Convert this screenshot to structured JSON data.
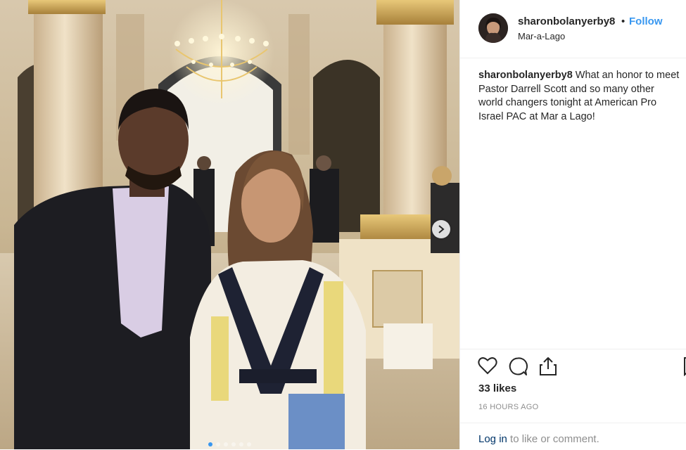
{
  "post": {
    "username": "sharonbolanyerby8",
    "separator": "•",
    "follow_label": "Follow",
    "location": "Mar-a-Lago",
    "caption_username": "sharonbolanyerby8",
    "caption_lines": [
      "What an honor to meet",
      "Pastor Darrell Scott and so many other",
      "world changers tonight at American Pro",
      "Israel PAC at Mar a Lago!"
    ],
    "likes": "33 likes",
    "timestamp": "16 HOURS AGO",
    "login_link": "Log in",
    "login_suffix": " to like or comment."
  },
  "carousel": {
    "slide_count": 6,
    "active_index": 0
  },
  "icons": {
    "like": "heart-icon",
    "comment": "comment-icon",
    "share": "share-icon",
    "save": "bookmark-icon",
    "next": "chevron-right-icon"
  },
  "colors": {
    "link_blue": "#3897f0",
    "login_blue": "#003569",
    "muted": "#8e8e8e",
    "text": "#262626"
  }
}
